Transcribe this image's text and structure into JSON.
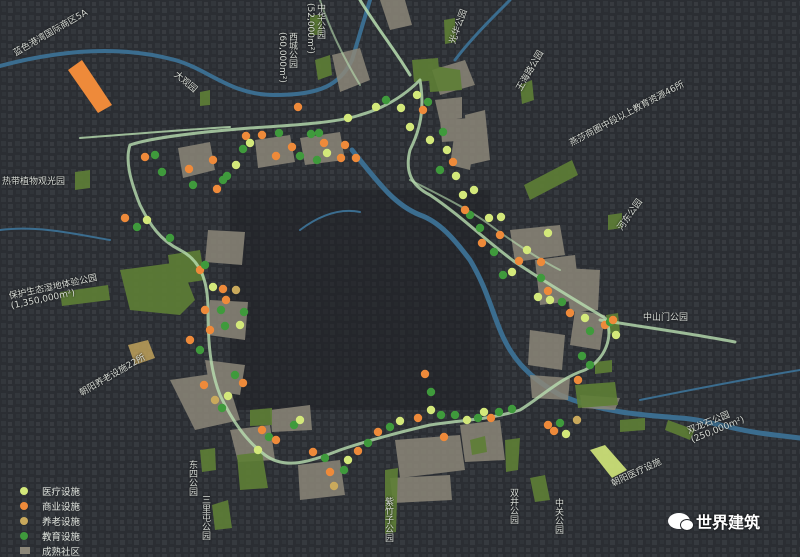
{
  "labels": {
    "l1": "蓝色港湾国际商区5A",
    "l2": "大观园",
    "l3": "西城公园\n(60,000m²)",
    "l4": "中华公园\n(52,000m²)",
    "l5": "光华公园",
    "l6": "王海路公园",
    "l7": "燕莎商圈中段以上教育资源46所",
    "l8": "热带植物观光园",
    "l9": "河东公园",
    "l10": "保护生态湿地体验公园\n(1,350,000m²)",
    "l11": "中山门公园",
    "l12": "朝阳养老设施22所",
    "l13": "东四公园",
    "l14": "三里屯公园",
    "l15": "双龙石公园\n(250,000m²)",
    "l16": "朝阳医疗设施",
    "l17": "中关公园",
    "l18": "双井公园",
    "l19": "紫竹子公园"
  },
  "legend": [
    {
      "label": "医疗设施",
      "color": "#d3e87a"
    },
    {
      "label": "商业设施",
      "color": "#ee8a3a"
    },
    {
      "label": "养老设施",
      "color": "#c9a95c"
    },
    {
      "label": "教育设施",
      "color": "#3f9a3c"
    },
    {
      "label": "成熟社区",
      "color": "#8c8779"
    }
  ],
  "watermark": "世界建筑",
  "colors": {
    "medical": "#d3e87a",
    "commercial": "#ee8a3a",
    "elderly": "#c9a95c",
    "education": "#3f9a3c",
    "community": "#8c8779",
    "park": "#5e7f36",
    "river": "#3b6d8f",
    "route": "#b9dfb0"
  }
}
